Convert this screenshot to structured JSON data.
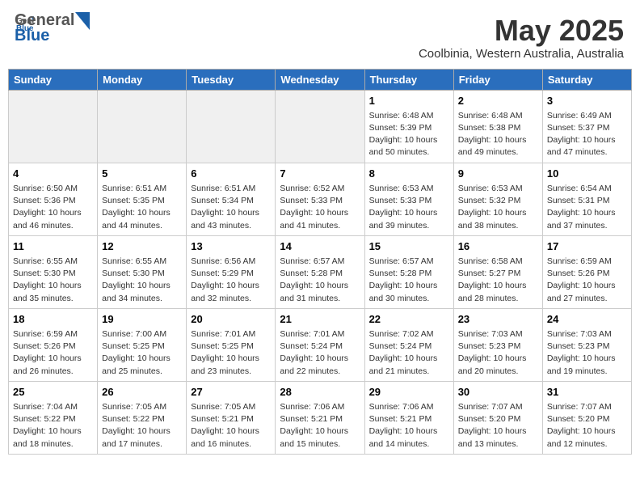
{
  "logo": {
    "line1": "General",
    "line2": "Blue"
  },
  "title": "May 2025",
  "subtitle": "Coolbinia, Western Australia, Australia",
  "weekdays": [
    "Sunday",
    "Monday",
    "Tuesday",
    "Wednesday",
    "Thursday",
    "Friday",
    "Saturday"
  ],
  "weeks": [
    [
      {
        "day": "",
        "info": ""
      },
      {
        "day": "",
        "info": ""
      },
      {
        "day": "",
        "info": ""
      },
      {
        "day": "",
        "info": ""
      },
      {
        "day": "1",
        "info": "Sunrise: 6:48 AM\nSunset: 5:39 PM\nDaylight: 10 hours\nand 50 minutes."
      },
      {
        "day": "2",
        "info": "Sunrise: 6:48 AM\nSunset: 5:38 PM\nDaylight: 10 hours\nand 49 minutes."
      },
      {
        "day": "3",
        "info": "Sunrise: 6:49 AM\nSunset: 5:37 PM\nDaylight: 10 hours\nand 47 minutes."
      }
    ],
    [
      {
        "day": "4",
        "info": "Sunrise: 6:50 AM\nSunset: 5:36 PM\nDaylight: 10 hours\nand 46 minutes."
      },
      {
        "day": "5",
        "info": "Sunrise: 6:51 AM\nSunset: 5:35 PM\nDaylight: 10 hours\nand 44 minutes."
      },
      {
        "day": "6",
        "info": "Sunrise: 6:51 AM\nSunset: 5:34 PM\nDaylight: 10 hours\nand 43 minutes."
      },
      {
        "day": "7",
        "info": "Sunrise: 6:52 AM\nSunset: 5:33 PM\nDaylight: 10 hours\nand 41 minutes."
      },
      {
        "day": "8",
        "info": "Sunrise: 6:53 AM\nSunset: 5:33 PM\nDaylight: 10 hours\nand 39 minutes."
      },
      {
        "day": "9",
        "info": "Sunrise: 6:53 AM\nSunset: 5:32 PM\nDaylight: 10 hours\nand 38 minutes."
      },
      {
        "day": "10",
        "info": "Sunrise: 6:54 AM\nSunset: 5:31 PM\nDaylight: 10 hours\nand 37 minutes."
      }
    ],
    [
      {
        "day": "11",
        "info": "Sunrise: 6:55 AM\nSunset: 5:30 PM\nDaylight: 10 hours\nand 35 minutes."
      },
      {
        "day": "12",
        "info": "Sunrise: 6:55 AM\nSunset: 5:30 PM\nDaylight: 10 hours\nand 34 minutes."
      },
      {
        "day": "13",
        "info": "Sunrise: 6:56 AM\nSunset: 5:29 PM\nDaylight: 10 hours\nand 32 minutes."
      },
      {
        "day": "14",
        "info": "Sunrise: 6:57 AM\nSunset: 5:28 PM\nDaylight: 10 hours\nand 31 minutes."
      },
      {
        "day": "15",
        "info": "Sunrise: 6:57 AM\nSunset: 5:28 PM\nDaylight: 10 hours\nand 30 minutes."
      },
      {
        "day": "16",
        "info": "Sunrise: 6:58 AM\nSunset: 5:27 PM\nDaylight: 10 hours\nand 28 minutes."
      },
      {
        "day": "17",
        "info": "Sunrise: 6:59 AM\nSunset: 5:26 PM\nDaylight: 10 hours\nand 27 minutes."
      }
    ],
    [
      {
        "day": "18",
        "info": "Sunrise: 6:59 AM\nSunset: 5:26 PM\nDaylight: 10 hours\nand 26 minutes."
      },
      {
        "day": "19",
        "info": "Sunrise: 7:00 AM\nSunset: 5:25 PM\nDaylight: 10 hours\nand 25 minutes."
      },
      {
        "day": "20",
        "info": "Sunrise: 7:01 AM\nSunset: 5:25 PM\nDaylight: 10 hours\nand 23 minutes."
      },
      {
        "day": "21",
        "info": "Sunrise: 7:01 AM\nSunset: 5:24 PM\nDaylight: 10 hours\nand 22 minutes."
      },
      {
        "day": "22",
        "info": "Sunrise: 7:02 AM\nSunset: 5:24 PM\nDaylight: 10 hours\nand 21 minutes."
      },
      {
        "day": "23",
        "info": "Sunrise: 7:03 AM\nSunset: 5:23 PM\nDaylight: 10 hours\nand 20 minutes."
      },
      {
        "day": "24",
        "info": "Sunrise: 7:03 AM\nSunset: 5:23 PM\nDaylight: 10 hours\nand 19 minutes."
      }
    ],
    [
      {
        "day": "25",
        "info": "Sunrise: 7:04 AM\nSunset: 5:22 PM\nDaylight: 10 hours\nand 18 minutes."
      },
      {
        "day": "26",
        "info": "Sunrise: 7:05 AM\nSunset: 5:22 PM\nDaylight: 10 hours\nand 17 minutes."
      },
      {
        "day": "27",
        "info": "Sunrise: 7:05 AM\nSunset: 5:21 PM\nDaylight: 10 hours\nand 16 minutes."
      },
      {
        "day": "28",
        "info": "Sunrise: 7:06 AM\nSunset: 5:21 PM\nDaylight: 10 hours\nand 15 minutes."
      },
      {
        "day": "29",
        "info": "Sunrise: 7:06 AM\nSunset: 5:21 PM\nDaylight: 10 hours\nand 14 minutes."
      },
      {
        "day": "30",
        "info": "Sunrise: 7:07 AM\nSunset: 5:20 PM\nDaylight: 10 hours\nand 13 minutes."
      },
      {
        "day": "31",
        "info": "Sunrise: 7:07 AM\nSunset: 5:20 PM\nDaylight: 10 hours\nand 12 minutes."
      }
    ]
  ]
}
